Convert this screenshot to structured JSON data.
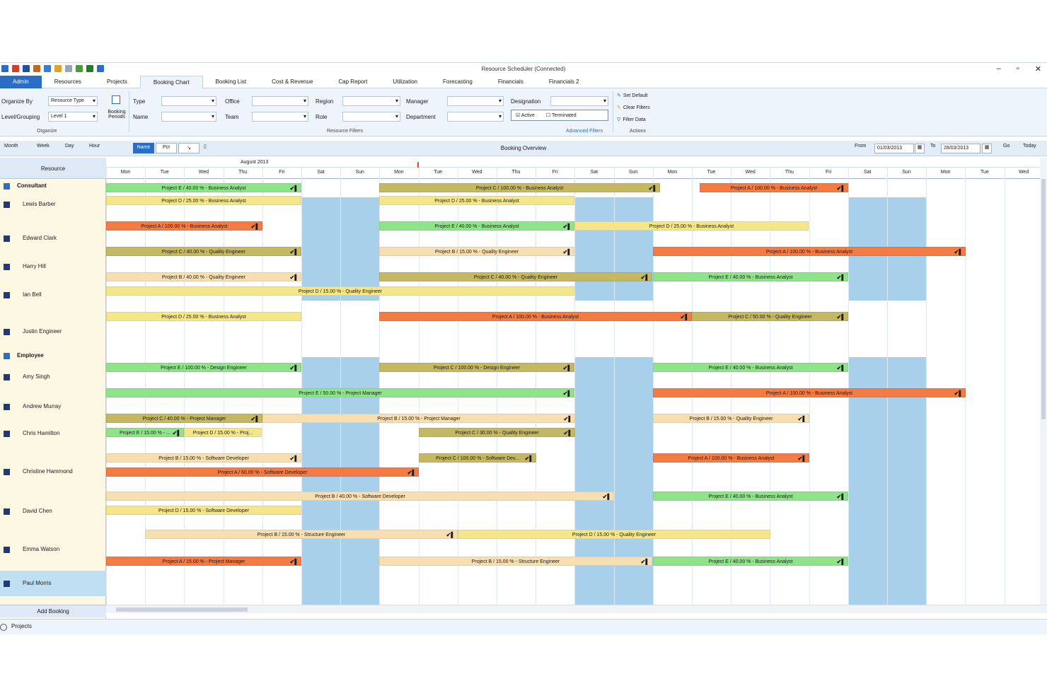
{
  "window": {
    "title": "Resource Scheduler (Connected)"
  },
  "ribbon_tabs": [
    "Admin",
    "Resources",
    "Projects",
    "Booking Chart",
    "Booking List",
    "Cost & Revenue",
    "Cap Report",
    "Utilization",
    "Forecasting",
    "Financials",
    "Financials 2"
  ],
  "ribbon": {
    "organize_by_label": "Organize By",
    "organize_by_value": "Resource Type",
    "level_label": "Level/Grouping",
    "level_value": "Level 1",
    "booking_label": "Booking Periods",
    "organize_group": "Organize",
    "type_label": "Type",
    "name_label": "Name",
    "office_label": "Office",
    "team_label": "Team",
    "region_label": "Region",
    "role_label": "Role",
    "manager_label": "Manager",
    "department_label": "Department",
    "designation_label": "Designation",
    "active_label": "Active",
    "terminated_label": "Terminated",
    "filter_group": "Resource Filters",
    "advanced_filters": "Advanced Filters",
    "set_default": "Set Default",
    "clear_filters": "Clear Filters",
    "filter_data": "Filter Data",
    "actions_group": "Actions"
  },
  "toolbar": {
    "month": "Month",
    "week": "Week",
    "day": "Day",
    "hour": "Hour",
    "btn_active": "Name",
    "btn2": "Pct",
    "title": "Booking Overview",
    "from_label": "From",
    "from_value": "01/03/2013",
    "to_label": "To",
    "to_value": "28/03/2013",
    "go": "Go",
    "today": "Today"
  },
  "timeline": {
    "month": "August 2013",
    "days": [
      "Mon",
      "Tue",
      "Wed",
      "Thu",
      "Fri",
      "Sat",
      "Sun",
      "Mon",
      "Tue",
      "Wed",
      "Thu",
      "Fri",
      "Sat",
      "Sun",
      "Mon",
      "Tue",
      "Wed",
      "Thu",
      "Fri",
      "Sat",
      "Sun",
      "Mon",
      "Tue",
      "Wed"
    ]
  },
  "resource_header": "Resource",
  "add_booking": "Add Booking",
  "status_bar": "Projects",
  "resources": [
    {
      "name": "Consultant",
      "group": true
    },
    {
      "name": "Lewis Barber"
    },
    {
      "name": "Edward Clark"
    },
    {
      "name": "Harry Hill"
    },
    {
      "name": "Ian Bell"
    },
    {
      "name": "Justin Engineer"
    },
    {
      "name": "Employee",
      "group": true
    },
    {
      "name": "Amy Singh"
    },
    {
      "name": "Andrew Murray"
    },
    {
      "name": "Chris Hamilton"
    },
    {
      "name": "Christine Hammond"
    },
    {
      "name": "David Chen"
    },
    {
      "name": "Emma Watson"
    },
    {
      "name": "Paul Morris"
    }
  ],
  "bookings": [
    {
      "label": "Project E / 40.00 % - Business Analyst",
      "color": "green",
      "check": true
    },
    {
      "label": "Project C / 100.00 % - Business Analyst",
      "color": "olive",
      "check": true
    },
    {
      "label": "Project A / 100.00 % - Business Analyst",
      "color": "orange",
      "check": true
    },
    {
      "label": "Project D / 25.00 % - Business Analyst",
      "color": "yellow",
      "check": false
    },
    {
      "label": "Project D / 25.00 % - Business Analyst",
      "color": "yellow",
      "check": false
    },
    {
      "label": "Project A / 100.00 % - Business Analyst",
      "color": "orange",
      "check": true
    },
    {
      "label": "Project E / 40.00 % - Business Analyst",
      "color": "green",
      "check": true
    },
    {
      "label": "Project D / 25.00 % - Business Analyst",
      "color": "yellow",
      "check": false
    },
    {
      "label": "Project C / 40.00 % - Quality Engineer",
      "color": "olive",
      "check": true
    },
    {
      "label": "Project B / 15.00 % - Quality Engineer",
      "color": "peach",
      "check": true
    },
    {
      "label": "Project A / 100.00 % - Business Analyst",
      "color": "orange",
      "check": true
    },
    {
      "label": "Project B / 40.00 % - Quality Engineer",
      "color": "peach",
      "check": true
    },
    {
      "label": "Project C / 40.00 % - Quality Engineer",
      "color": "olive",
      "check": true
    },
    {
      "label": "Project E / 40.00 % - Business Analyst",
      "color": "green",
      "check": true
    },
    {
      "label": "Project D / 15.00 % - Quality Engineer",
      "color": "yellow",
      "check": false
    },
    {
      "label": "Project D / 25.00 % - Business Analyst",
      "color": "yellow",
      "check": false
    },
    {
      "label": "Project A / 100.00 % - Business Analyst",
      "color": "orange",
      "check": true
    },
    {
      "label": "Project C / 50.00 % - Quality Engineer",
      "color": "olive",
      "check": true
    },
    {
      "label": "Project E / 100.00 % - Design Engineer",
      "color": "green",
      "check": true
    },
    {
      "label": "Project C / 100.00 % - Design Engineer",
      "color": "olive",
      "check": true
    },
    {
      "label": "Project E / 40.00 % - Business Analyst",
      "color": "green",
      "check": true
    },
    {
      "label": "Project E / 50.00 % - Project Manager",
      "color": "green",
      "check": true
    },
    {
      "label": "Project A / 100.00 % - Business Analyst",
      "color": "orange",
      "check": true
    },
    {
      "label": "Project C / 40.00 % - Project Manager",
      "color": "olive",
      "check": true
    },
    {
      "label": "Project B / 15.00 % - Project Manager",
      "color": "peach",
      "check": true
    },
    {
      "label": "Project B / 15.00 % - Quality Engineer",
      "color": "peach",
      "check": true
    },
    {
      "label": "Project E / 15.00 % - ...",
      "color": "green",
      "check": true
    },
    {
      "label": "Project D / 15.00 % - Proj...",
      "color": "yellow",
      "check": false
    },
    {
      "label": "Project C / 30.00 % - Quality Engineer",
      "color": "olive",
      "check": true
    },
    {
      "label": "Project B / 15.00 % - Software Developer",
      "color": "peach",
      "check": true
    },
    {
      "label": "Project C / 100.00 % - Software Dev...",
      "color": "olive",
      "check": true
    },
    {
      "label": "Project A / 100.00 % - Business Analyst",
      "color": "orange",
      "check": true
    },
    {
      "label": "Project A / 60.00 % - Software Developer",
      "color": "orange",
      "check": true
    },
    {
      "label": "Project B / 40.00 % - Software Developer",
      "color": "peach",
      "check": true
    },
    {
      "label": "Project E / 40.00 % - Business Analyst",
      "color": "green",
      "check": true
    },
    {
      "label": "Project D / 15.00 % - Software Developer",
      "color": "yellow",
      "check": false
    },
    {
      "label": "Project B / 15.00 % - Structure Engineer",
      "color": "peach",
      "check": true
    },
    {
      "label": "Project D / 15.00 % - Quality Engineer",
      "color": "yellow",
      "check": false
    },
    {
      "label": "Project A / 15.00 % - Project Manager",
      "color": "orange",
      "check": true
    },
    {
      "label": "Project B / 15.00 % - Structure Engineer",
      "color": "peach",
      "check": true
    },
    {
      "label": "Project E / 40.00 % - Business Analyst",
      "color": "green",
      "check": true
    }
  ],
  "check_glyph": "✔▌"
}
